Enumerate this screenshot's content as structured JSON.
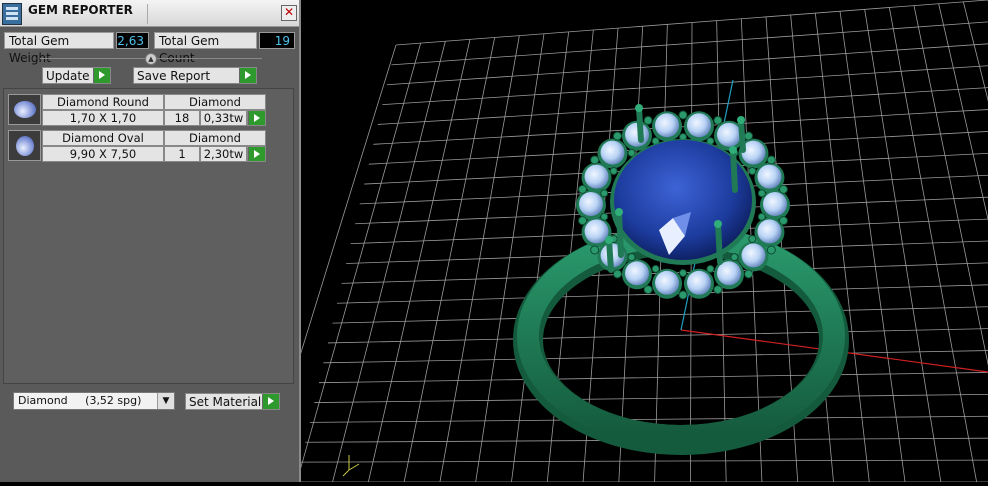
{
  "window": {
    "title": "GEM REPORTER",
    "close": "✕"
  },
  "stats": {
    "weight_label": "Total Gem Weight",
    "weight_value": "2,63",
    "count_label": "Total Gem Count",
    "count_value": "19"
  },
  "buttons": {
    "update": "Update",
    "save_report": "Save Report",
    "set_material": "Set Material"
  },
  "gems": [
    {
      "name": "Diamond Round",
      "material": "Diamond",
      "size": "1,70 X 1,70",
      "count": "18",
      "weight": "0,33tw",
      "thumb_icon": "round-gem-icon"
    },
    {
      "name": "Diamond Oval",
      "material": "Diamond",
      "size": "9,90 X 7,50",
      "count": "1",
      "weight": "2,30tw",
      "thumb_icon": "oval-gem-icon"
    }
  ],
  "material_select": {
    "value": "Diamond     (3,52 spg)"
  },
  "colors": {
    "panel_bg": "#5a5a5a",
    "value_text": "#4fc3ea",
    "play_green": "#2e9a2e",
    "ring_green": "#1f7a55",
    "center_stone": "#1d3c9e",
    "halo_stone": "#b9d3f5",
    "grid": "#9a9a9a",
    "axis_x": "#d02020",
    "axis_y": "#20a0c0"
  }
}
